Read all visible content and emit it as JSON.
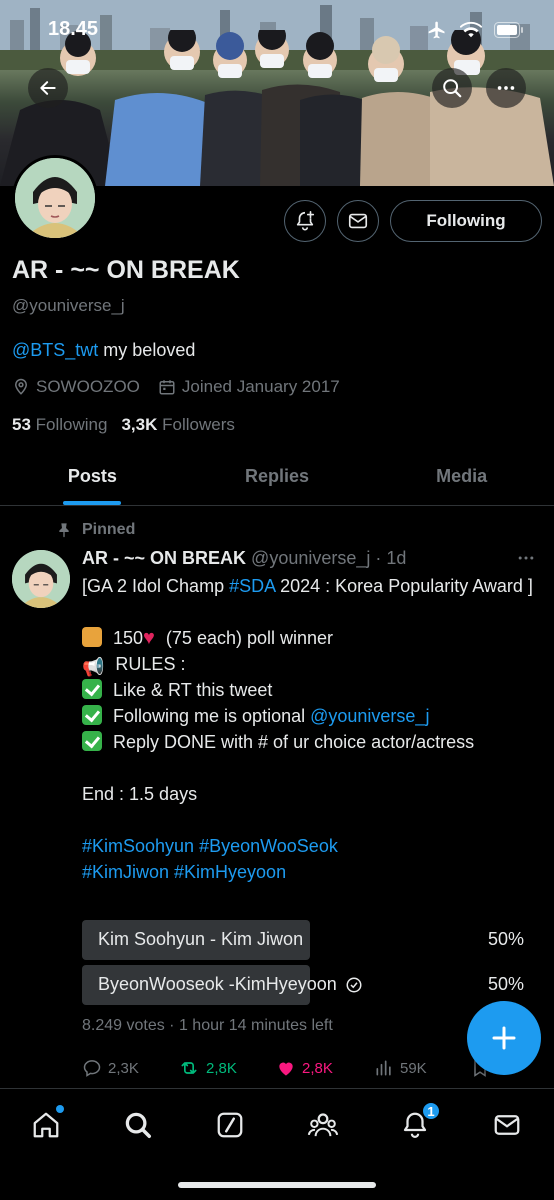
{
  "status_bar": {
    "time": "18.45"
  },
  "profile": {
    "display_name": "AR - ~~ ON BREAK",
    "handle": "@youniverse_j",
    "bio_mention": "@BTS_twt",
    "bio_text": " my beloved",
    "location": "SOWOOZOO",
    "joined": "Joined January 2017",
    "following_count": "53",
    "following_label": "Following",
    "followers_count": "3,3K",
    "followers_label": "Followers",
    "follow_button": "Following"
  },
  "tabs": [
    {
      "label": "Posts",
      "active": true
    },
    {
      "label": "Replies",
      "active": false
    },
    {
      "label": "Media",
      "active": false
    }
  ],
  "tweet": {
    "pinned_label": "Pinned",
    "name": "AR - ~~ ON BREAK",
    "handle": "@youniverse_j",
    "time": "· 1d",
    "line1_a": "[GA 2 Idol Champ ",
    "line1_tag": "#SDA",
    "line1_b": " 2024 : Korea Popularity Award ]",
    "prize_a": " 150",
    "prize_b": " (75 each) poll winner",
    "rules": " RULES :",
    "rule1": " Like & RT this tweet",
    "rule2_a": " Following me is optional ",
    "rule2_mention": "@youniverse_j",
    "rule3": " Reply DONE with # of ur choice actor/actress",
    "end": "End : 1.5 days",
    "hashtags_line1": "#KimSoohyun #ByeonWooSeok",
    "hashtags_line2": "#KimJiwon #KimHyeyoon",
    "poll": [
      {
        "label": "Kim Soohyun - Kim Jiwon",
        "percent": "50%",
        "share": 0.5,
        "selected": false
      },
      {
        "label": "ByeonWooseok -KimHyeyoon",
        "percent": "50%",
        "share": 0.5,
        "selected": true
      }
    ],
    "votes": "8.249 votes · 1 hour 14 minutes left",
    "replies": "2,3K",
    "reposts": "2,8K",
    "likes": "2,8K",
    "views": "59K"
  },
  "bottom_nav": {
    "notifications_badge": "1"
  },
  "colors": {
    "accent": "#1d9bf0",
    "repost": "#00ba7c",
    "like": "#f91880",
    "muted": "#71767b"
  }
}
